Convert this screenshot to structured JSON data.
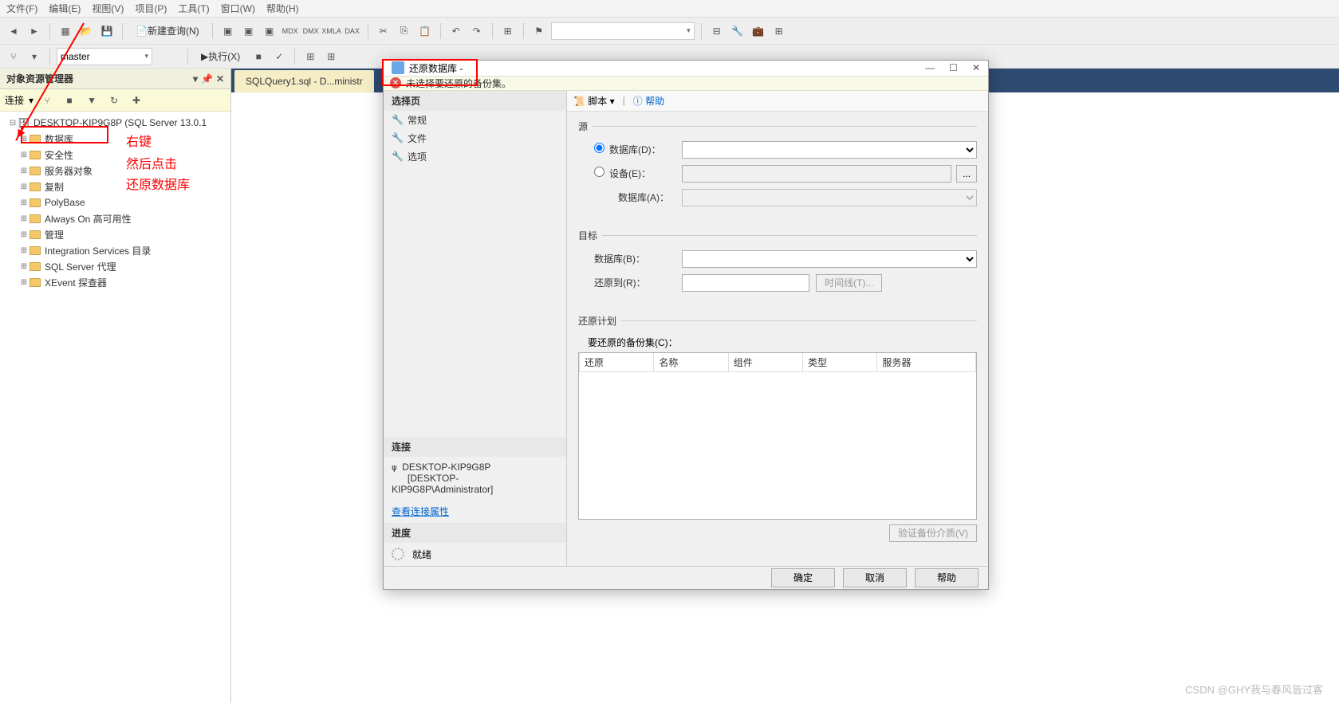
{
  "menubar": [
    "文件(F)",
    "编辑(E)",
    "视图(V)",
    "项目(P)",
    "工具(T)",
    "窗口(W)",
    "帮助(H)"
  ],
  "toolbar": {
    "new_query": "新建查询(N)",
    "master": "master",
    "execute": "执行(X)"
  },
  "explorer": {
    "title": "对象资源管理器",
    "connect": "连接",
    "server": "DESKTOP-KIP9G8P (SQL Server 13.0.1",
    "nodes": [
      "数据库",
      "安全性",
      "服务器对象",
      "复制",
      "PolyBase",
      "Always On 高可用性",
      "管理",
      "Integration Services 目录",
      "SQL Server 代理",
      "XEvent 探查器"
    ]
  },
  "annotations": {
    "right_click": "右键",
    "then_click": "然后点击",
    "restore_db": "还原数据库"
  },
  "tab": {
    "label": "SQLQuery1.sql - D...ministr"
  },
  "dialog": {
    "title": "还原数据库 - ",
    "warning": "未选择要还原的备份集。",
    "minimize": "—",
    "maximize": "☐",
    "close": "✕",
    "left": {
      "select_page": "选择页",
      "pages": [
        "常规",
        "文件",
        "选项"
      ],
      "connection": "连接",
      "conn_server": "DESKTOP-KIP9G8P",
      "conn_user": "[DESKTOP-KIP9G8P\\Administrator]",
      "view_link": "查看连接属性",
      "progress": "进度",
      "ready": "就绪"
    },
    "right": {
      "script": "脚本",
      "help": "帮助",
      "source": "源",
      "db_radio": "数据库(D)：",
      "device_radio": "设备(E)：",
      "db_sub": "数据库(A)：",
      "target": "目标",
      "target_db": "数据库(B)：",
      "restore_to": "还原到(R)：",
      "timeline_btn": "时间线(T)...",
      "plan": "还原计划",
      "backup_sets": "要还原的备份集(C)：",
      "cols": [
        "还原",
        "名称",
        "组件",
        "类型",
        "服务器"
      ],
      "verify": "验证备份介质(V)"
    },
    "buttons": {
      "ok": "确定",
      "cancel": "取消",
      "help": "帮助"
    }
  },
  "watermark": "CSDN @GHY我与春风皆过客"
}
